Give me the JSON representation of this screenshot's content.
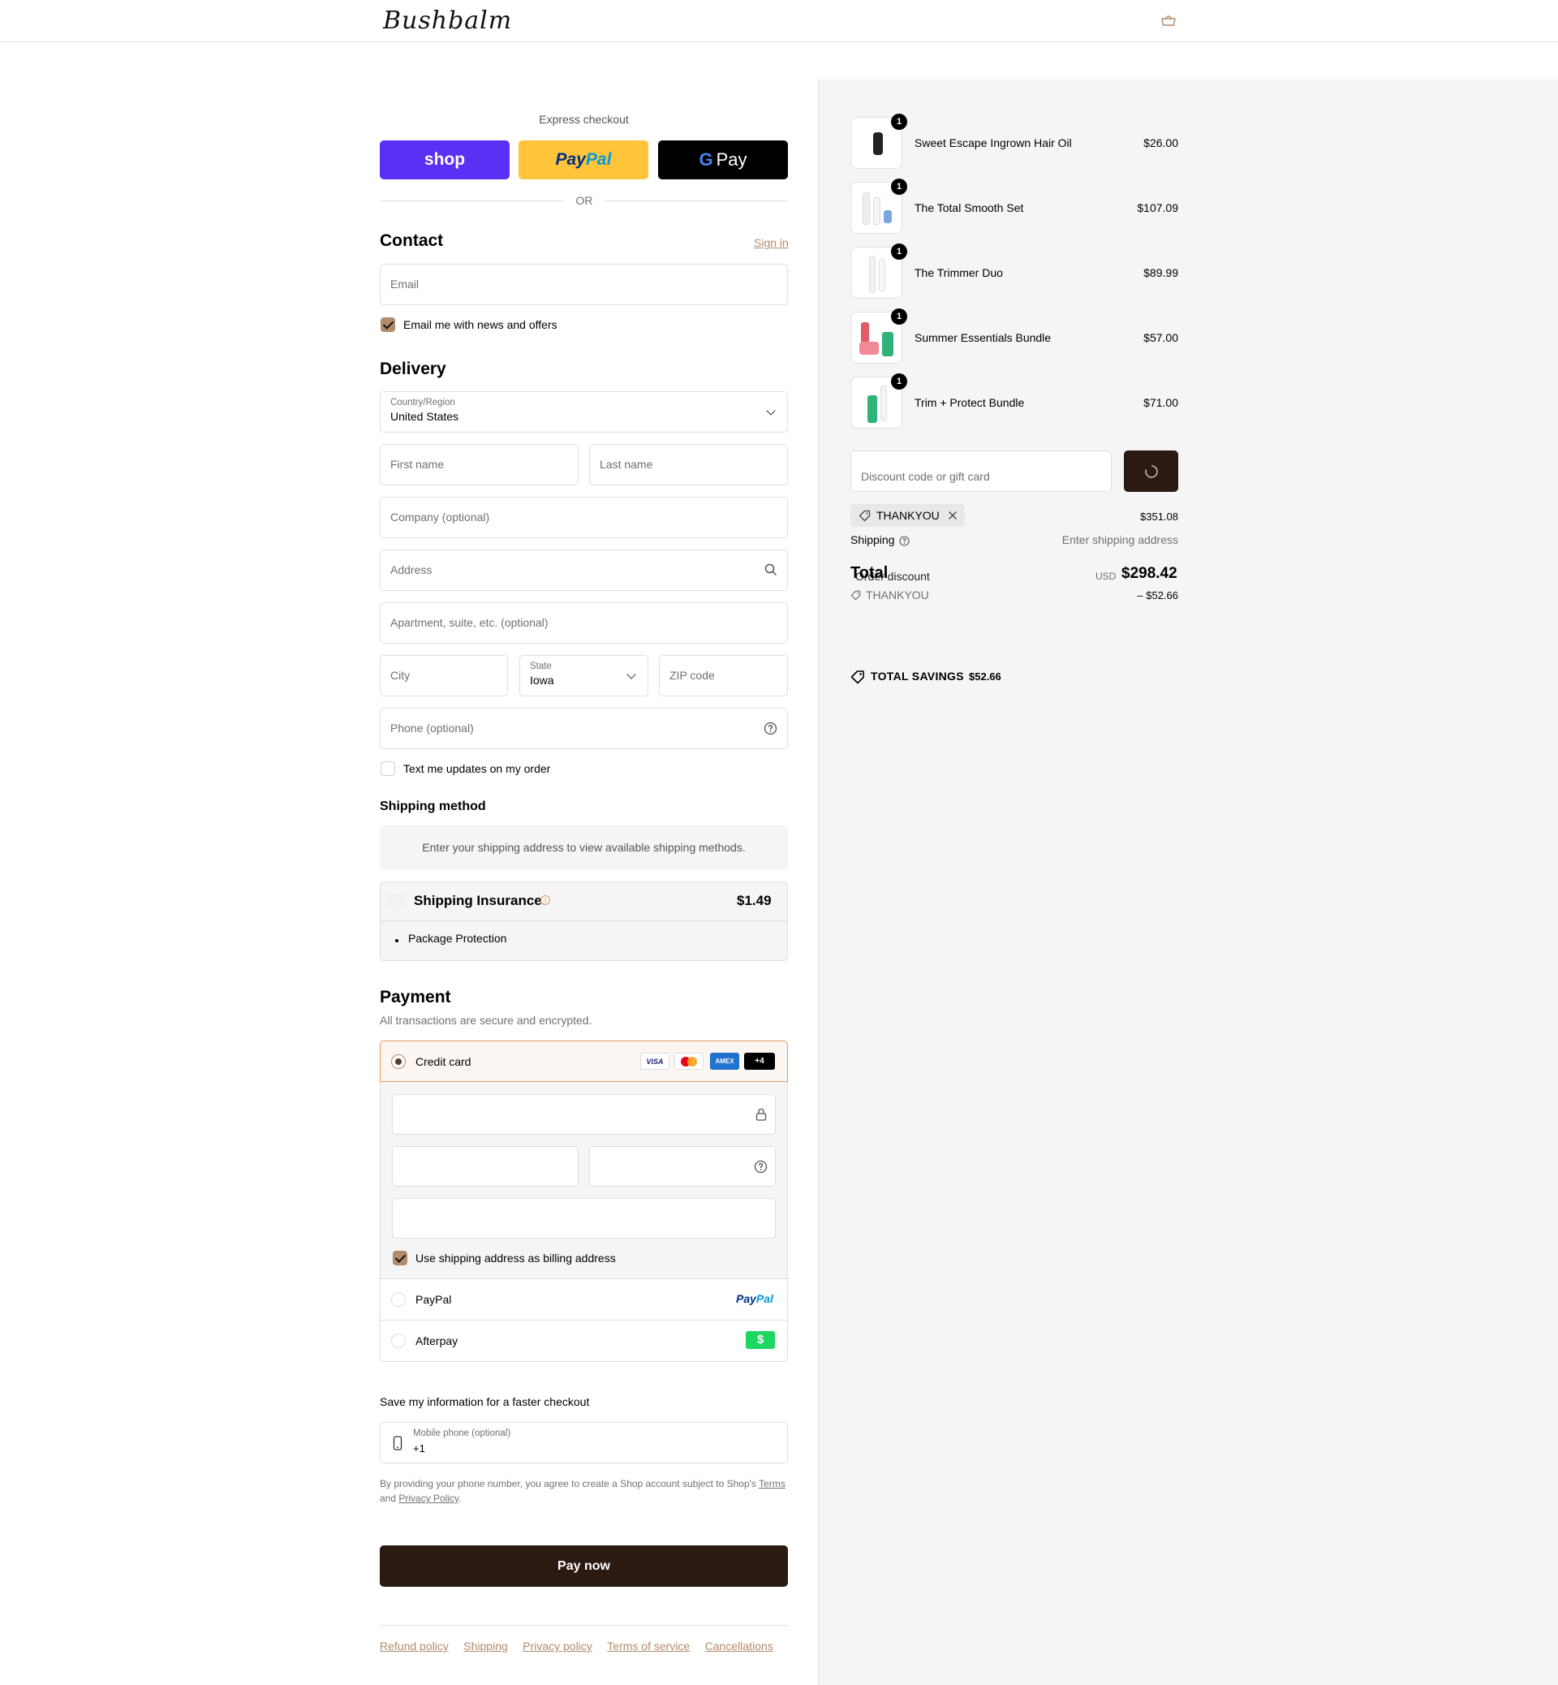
{
  "brand": {
    "name": "Bushbalm",
    "accent": "#b38a6a",
    "dark": "#2a1a12"
  },
  "express": {
    "title": "Express checkout",
    "shop_label": "shop",
    "paypal_label_a": "Pay",
    "paypal_label_b": "Pal",
    "gpay_g": "G",
    "gpay_label": "Pay",
    "or_label": "OR"
  },
  "contact": {
    "title": "Contact",
    "sign_in": "Sign in",
    "email_placeholder": "Email",
    "newsletter_label": "Email me with news and offers",
    "newsletter_checked": true
  },
  "delivery": {
    "title": "Delivery",
    "country_label": "Country/Region",
    "country_value": "United States",
    "first_name_placeholder": "First name",
    "last_name_placeholder": "Last name",
    "company_placeholder": "Company (optional)",
    "address_placeholder": "Address",
    "apartment_placeholder": "Apartment, suite, etc. (optional)",
    "city_placeholder": "City",
    "state_label": "State",
    "state_value": "Iowa",
    "zip_placeholder": "ZIP code",
    "phone_placeholder": "Phone (optional)",
    "sms_label": "Text me updates on my order",
    "sms_checked": false
  },
  "shipping_method": {
    "title": "Shipping method",
    "empty_message": "Enter your shipping address to view available shipping methods."
  },
  "insurance": {
    "title": "Shipping Insurance",
    "info_icon": "i",
    "price": "$1.49",
    "bullet": "Package Protection"
  },
  "payment": {
    "title": "Payment",
    "subtitle": "All transactions are secure and encrypted.",
    "credit_card_label": "Credit card",
    "card_brands": [
      "VISA",
      "AMEX",
      "+4"
    ],
    "billing_label": "Use shipping address as billing address",
    "billing_checked": true,
    "paypal_label": "PayPal",
    "paypal_logo_a": "Pay",
    "paypal_logo_b": "Pal",
    "afterpay_label": "Afterpay",
    "afterpay_logo": "$"
  },
  "save_info": {
    "title": "Save my information for a faster checkout",
    "mobile_label": "Mobile phone (optional)",
    "mobile_value": "+1",
    "legal_prefix": "By providing your phone number, you agree to create a Shop account subject to Shop's",
    "terms_link": "Terms",
    "legal_and": "and",
    "privacy_link": "Privacy Policy",
    "legal_suffix": "."
  },
  "pay_now": "Pay now",
  "footer_links": [
    "Refund policy",
    "Shipping",
    "Privacy policy",
    "Terms of service",
    "Cancellations"
  ],
  "summary": {
    "items": [
      {
        "name": "Sweet Escape Ingrown Hair Oil",
        "price": "$26.00",
        "qty": "1"
      },
      {
        "name": "The Total Smooth Set",
        "price": "$107.09",
        "qty": "1"
      },
      {
        "name": "The Trimmer Duo",
        "price": "$89.99",
        "qty": "1"
      },
      {
        "name": "Summer Essentials Bundle",
        "price": "$57.00",
        "qty": "1"
      },
      {
        "name": "Trim + Protect Bundle",
        "price": "$71.00",
        "qty": "1"
      }
    ],
    "discount_placeholder": "Discount code or gift card",
    "applied_code": "THANKYOU",
    "subtotal": "$351.08",
    "shipping_label": "Shipping",
    "shipping_value": "Enter shipping address",
    "total_label": "Total",
    "order_discount_label": "Order discount",
    "currency": "USD",
    "total": "$298.42",
    "discount_code": "THANKYOU",
    "discount_amount": "– $52.66",
    "savings_label": "TOTAL SAVINGS",
    "savings_amount": "$52.66"
  }
}
